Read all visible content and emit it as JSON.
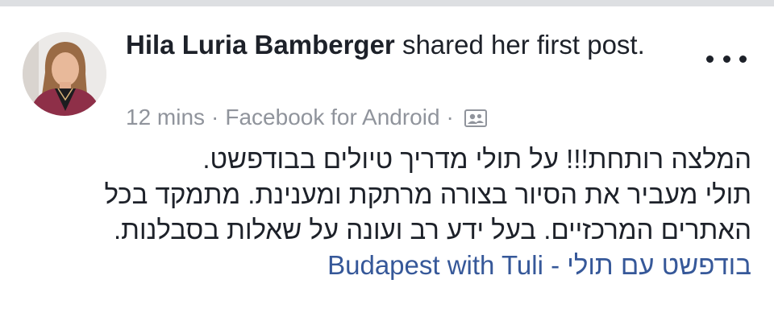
{
  "post": {
    "author": "Hila Luria Bamberger",
    "action": " shared her first post.",
    "timestamp": "12 mins",
    "separator": "·",
    "source": "Facebook for Android",
    "audience_icon": "friends-icon",
    "more_icon": "more-options-icon",
    "body_lines": [
      "המלצה רותחת!!! על תולי מדריך טיולים בבודפשט.",
      "תולי מעביר את הסיור בצורה מרתקת ומענינת. מתמקד בכל",
      "האתרים המרכזיים. בעל ידע רב ועונה על שאלות בסבלנות."
    ],
    "page_link": "בודפשט עם תולי - Budapest with Tuli"
  },
  "colors": {
    "text": "#1d2129",
    "meta": "#90949c",
    "link": "#365899",
    "divider": "#dddfe2"
  }
}
